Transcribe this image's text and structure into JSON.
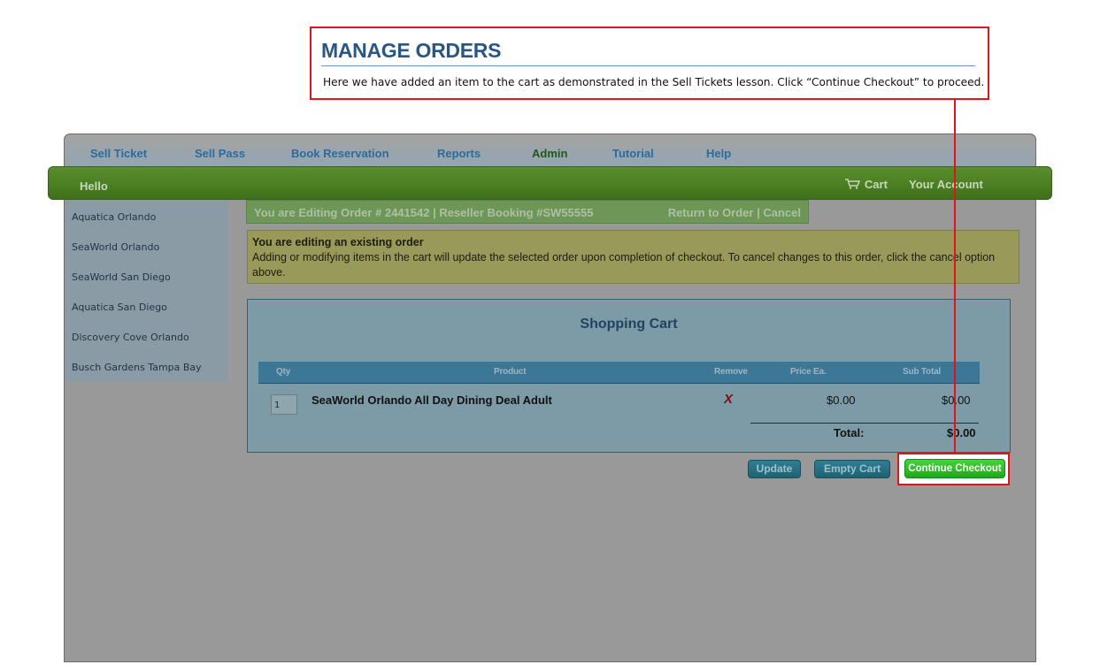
{
  "callout": {
    "title": "MANAGE ORDERS",
    "text": "Here we have added an item to the cart as demonstrated in the Sell Tickets lesson. Click “Continue Checkout” to proceed."
  },
  "nav": {
    "items": [
      {
        "label": "Sell Ticket"
      },
      {
        "label": "Sell Pass"
      },
      {
        "label": "Book Reservation"
      },
      {
        "label": "Reports"
      },
      {
        "label": "Admin"
      },
      {
        "label": "Tutorial"
      },
      {
        "label": "Help"
      }
    ],
    "active": "Admin"
  },
  "header": {
    "greeting": "Hello",
    "cart_icon": "cart-icon",
    "cart_label": "Cart",
    "account_label": "Your Account"
  },
  "sidebar": {
    "items": [
      {
        "label": "Aquatica Orlando"
      },
      {
        "label": "SeaWorld Orlando"
      },
      {
        "label": "SeaWorld San Diego"
      },
      {
        "label": "Aquatica San Diego"
      },
      {
        "label": "Discovery Cove Orlando"
      },
      {
        "label": "Busch Gardens Tampa Bay"
      }
    ]
  },
  "editing": {
    "text": "You are Editing Order # 2441542  | Reseller Booking #SW55555",
    "return_label": "Return to Order",
    "separator": " | ",
    "cancel_label": "Cancel"
  },
  "notice": {
    "heading": "You are editing an existing order",
    "body": "Adding or modifying items in the cart will update the selected order upon completion of checkout. To cancel changes to this order, click the cancel option above."
  },
  "cart": {
    "title": "Shopping Cart",
    "columns": [
      "Qty",
      "Product",
      "Remove",
      "Price Ea.",
      "Sub Total"
    ],
    "rows": [
      {
        "qty": "1",
        "product": "SeaWorld Orlando All Day Dining Deal Adult",
        "remove": "X",
        "price": "$0.00",
        "subtotal": "$0.00"
      }
    ],
    "total_label": "Total:",
    "total_value": "$0.00"
  },
  "buttons": {
    "update": "Update",
    "empty": "Empty Cart",
    "checkout": "Continue Checkout"
  },
  "colors": {
    "callout_border": "#e0151b",
    "nav_active": "#1c5a17",
    "checkout_green": "#1fa81b"
  }
}
